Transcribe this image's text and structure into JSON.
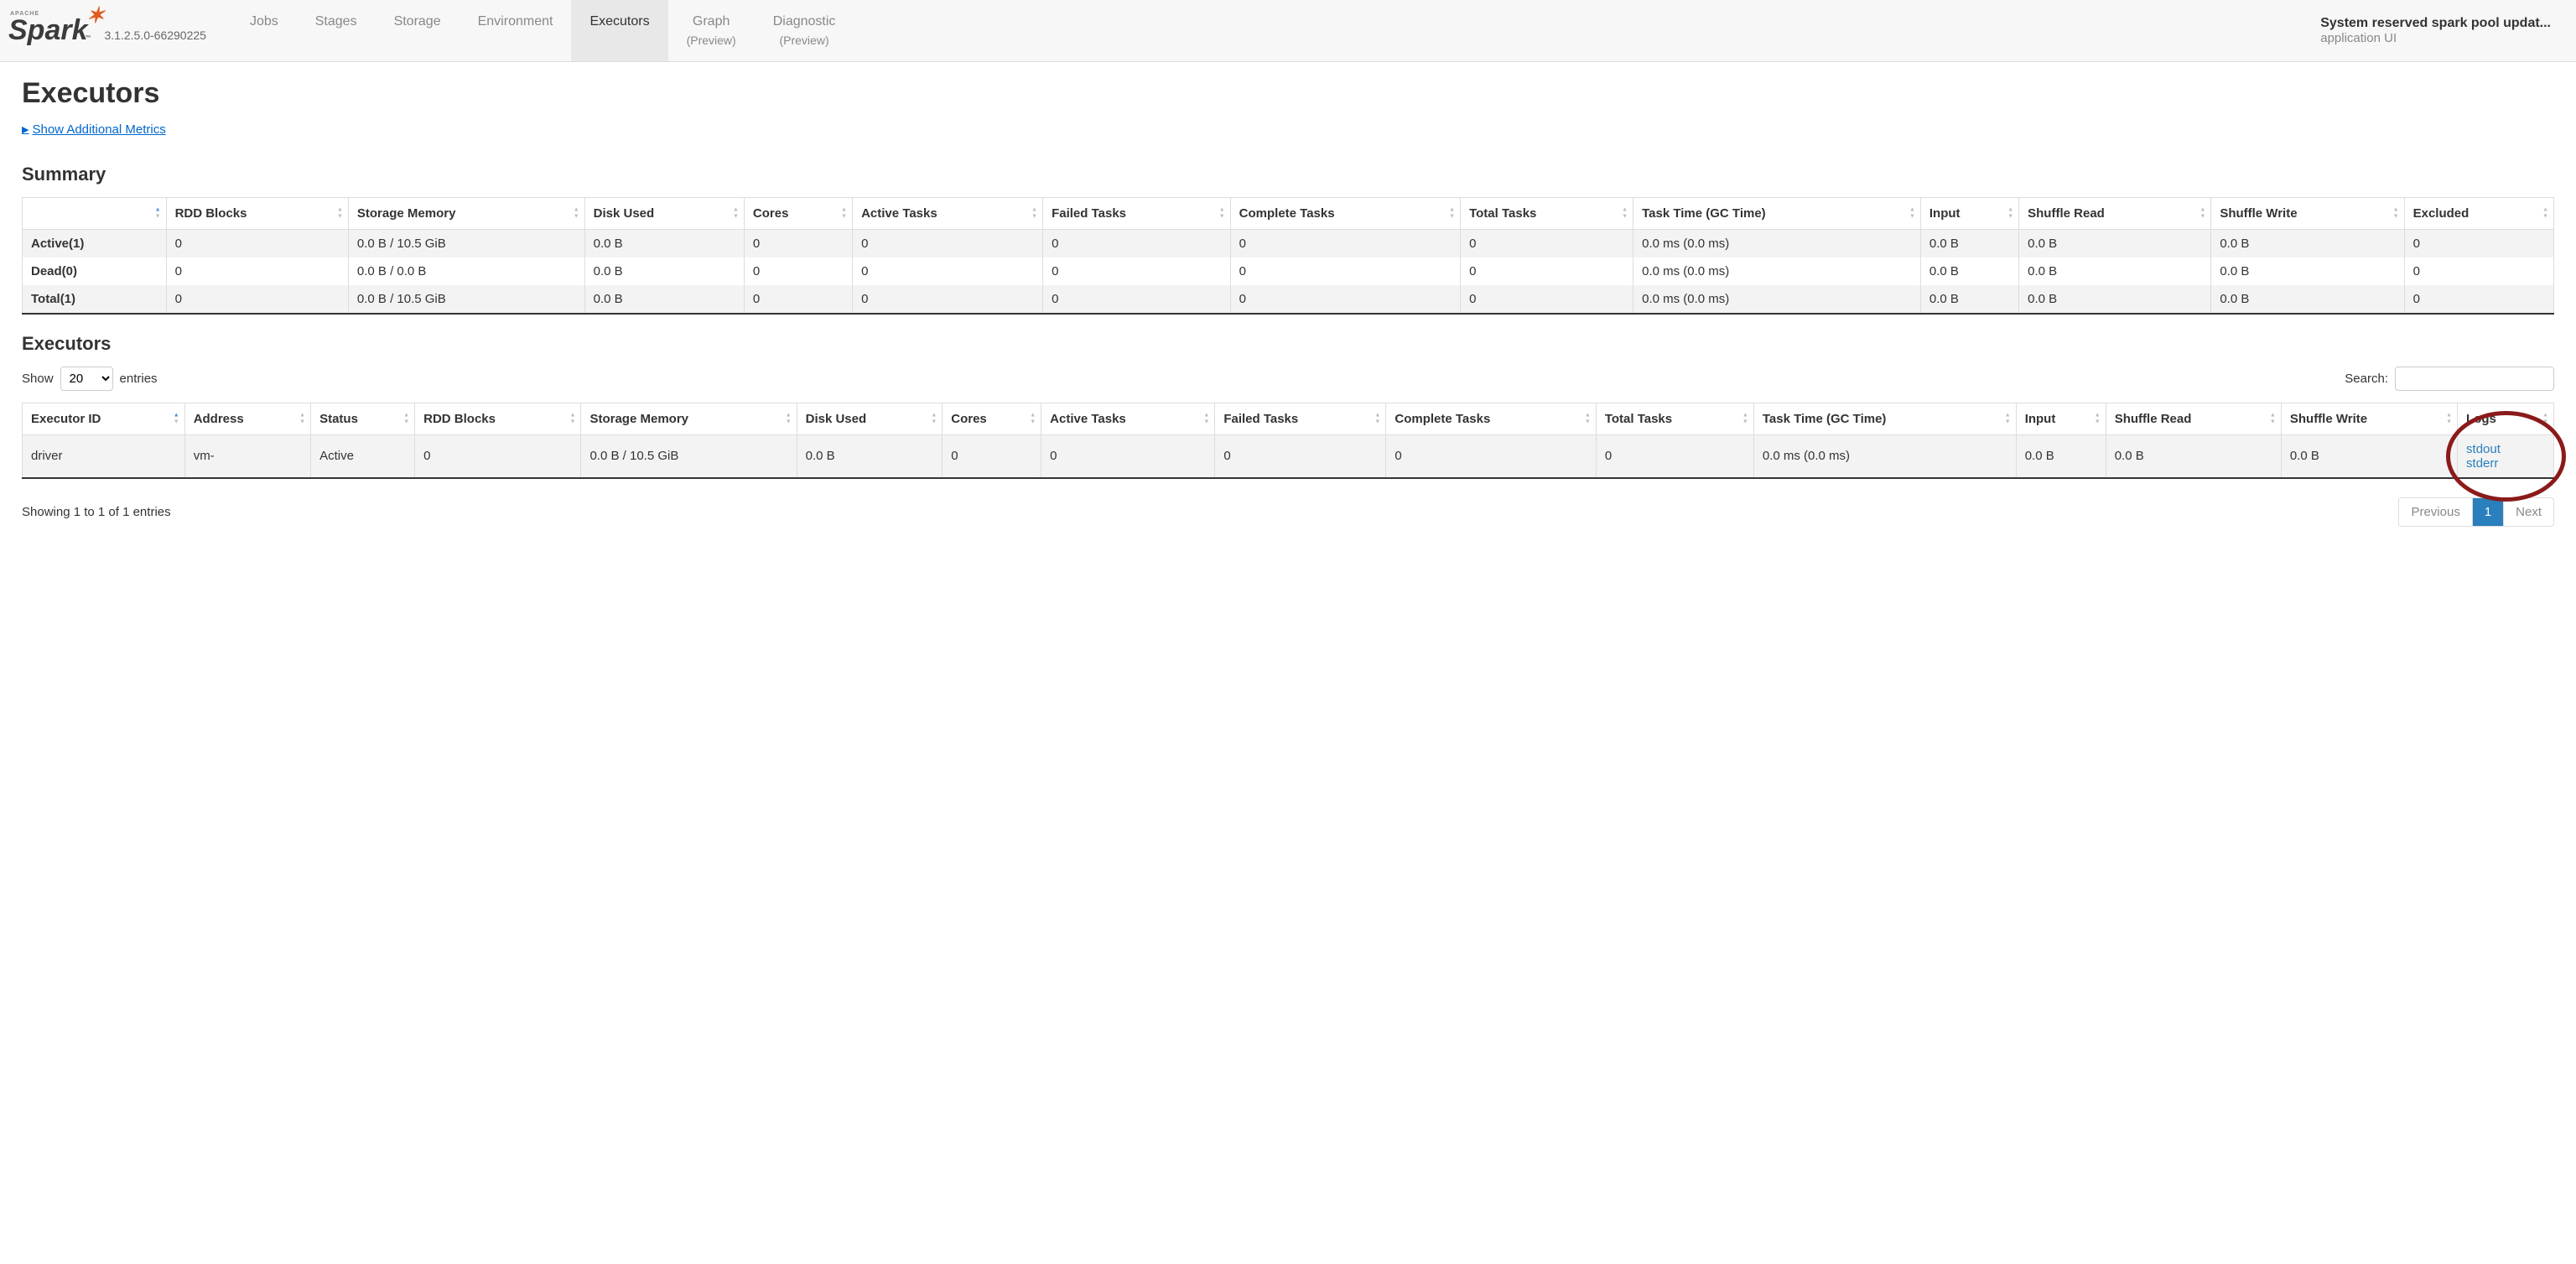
{
  "navbar": {
    "logo": {
      "brand": "Spark",
      "apache": "APACHE",
      "tm": "™"
    },
    "version": "3.1.2.5.0-66290225",
    "tabs": [
      {
        "label": "Jobs",
        "sub": ""
      },
      {
        "label": "Stages",
        "sub": ""
      },
      {
        "label": "Storage",
        "sub": ""
      },
      {
        "label": "Environment",
        "sub": ""
      },
      {
        "label": "Executors",
        "sub": ""
      },
      {
        "label": "Graph",
        "sub": "(Preview)"
      },
      {
        "label": "Diagnostic",
        "sub": "(Preview)"
      }
    ],
    "active_tab_index": 4,
    "right": {
      "title": "System reserved spark pool updat...",
      "sub": "application UI"
    }
  },
  "page": {
    "title": "Executors",
    "metrics_toggle": "Show Additional Metrics"
  },
  "summary": {
    "heading": "Summary",
    "headers": [
      "",
      "RDD Blocks",
      "Storage Memory",
      "Disk Used",
      "Cores",
      "Active Tasks",
      "Failed Tasks",
      "Complete Tasks",
      "Total Tasks",
      "Task Time (GC Time)",
      "Input",
      "Shuffle Read",
      "Shuffle Write",
      "Excluded"
    ],
    "rows": [
      {
        "label": "Active(1)",
        "cells": [
          "0",
          "0.0 B / 10.5 GiB",
          "0.0 B",
          "0",
          "0",
          "0",
          "0",
          "0",
          "0.0 ms (0.0 ms)",
          "0.0 B",
          "0.0 B",
          "0.0 B",
          "0"
        ]
      },
      {
        "label": "Dead(0)",
        "cells": [
          "0",
          "0.0 B / 0.0 B",
          "0.0 B",
          "0",
          "0",
          "0",
          "0",
          "0",
          "0.0 ms (0.0 ms)",
          "0.0 B",
          "0.0 B",
          "0.0 B",
          "0"
        ]
      },
      {
        "label": "Total(1)",
        "cells": [
          "0",
          "0.0 B / 10.5 GiB",
          "0.0 B",
          "0",
          "0",
          "0",
          "0",
          "0",
          "0.0 ms (0.0 ms)",
          "0.0 B",
          "0.0 B",
          "0.0 B",
          "0"
        ]
      }
    ]
  },
  "executors": {
    "heading": "Executors",
    "show_label": "Show",
    "entries_label": "entries",
    "page_size": "20",
    "search_label": "Search:",
    "search_value": "",
    "headers": [
      "Executor ID",
      "Address",
      "Status",
      "RDD Blocks",
      "Storage Memory",
      "Disk Used",
      "Cores",
      "Active Tasks",
      "Failed Tasks",
      "Complete Tasks",
      "Total Tasks",
      "Task Time (GC Time)",
      "Input",
      "Shuffle Read",
      "Shuffle Write",
      "Logs"
    ],
    "rows": [
      {
        "cells": [
          "driver",
          "vm-",
          "Active",
          "0",
          "0.0 B / 10.5 GiB",
          "0.0 B",
          "0",
          "0",
          "0",
          "0",
          "0",
          "0.0 ms (0.0 ms)",
          "0.0 B",
          "0.0 B",
          "0.0 B"
        ],
        "logs": [
          "stdout",
          "stderr"
        ]
      }
    ],
    "info": "Showing 1 to 1 of 1 entries",
    "prev": "Previous",
    "page1": "1",
    "next": "Next"
  }
}
